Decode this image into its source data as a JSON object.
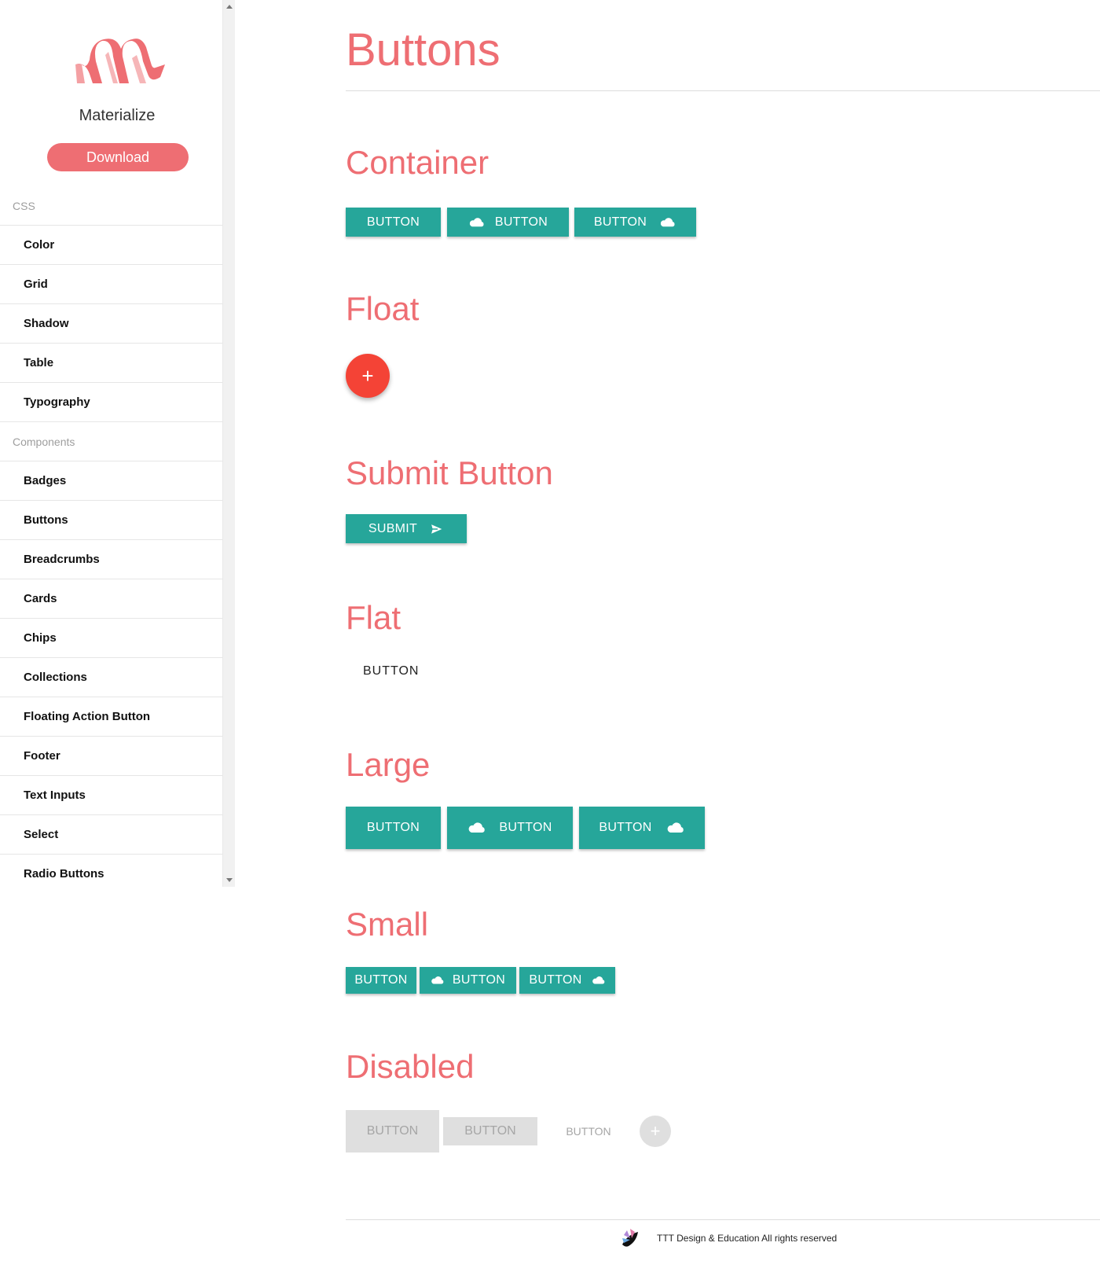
{
  "sidebar": {
    "brand": "Materialize",
    "download_label": "Download",
    "nav": [
      {
        "type": "section",
        "label": "CSS"
      },
      {
        "type": "item",
        "label": "Color"
      },
      {
        "type": "item",
        "label": "Grid"
      },
      {
        "type": "item",
        "label": "Shadow"
      },
      {
        "type": "item",
        "label": "Table"
      },
      {
        "type": "item",
        "label": "Typography"
      },
      {
        "type": "section",
        "label": "Components"
      },
      {
        "type": "item",
        "label": "Badges"
      },
      {
        "type": "item",
        "label": "Buttons"
      },
      {
        "type": "item",
        "label": "Breadcrumbs"
      },
      {
        "type": "item",
        "label": "Cards"
      },
      {
        "type": "item",
        "label": "Chips"
      },
      {
        "type": "item",
        "label": "Collections"
      },
      {
        "type": "item",
        "label": "Floating Action Button"
      },
      {
        "type": "item",
        "label": "Footer"
      },
      {
        "type": "item",
        "label": "Text Inputs"
      },
      {
        "type": "item",
        "label": "Select"
      },
      {
        "type": "item",
        "label": "Radio Buttons"
      }
    ]
  },
  "main": {
    "title": "Buttons",
    "sections": {
      "container": "Container",
      "float": "Float",
      "submit": "Submit Button",
      "flat": "Flat",
      "large": "Large",
      "small": "Small",
      "disabled": "Disabled"
    },
    "button_label": "BUTTON",
    "submit_label": "SUBMIT",
    "fab_label": "+",
    "flat_label": "BUTTON",
    "disabled_fab_label": "+"
  },
  "footer": {
    "text": "TTT Design & Education All rights reserved"
  },
  "colors": {
    "accent": "#ee6e73",
    "teal": "#26a69a",
    "fab_red": "#f44336",
    "disabled": "#dfdfdf"
  },
  "icons": {
    "cloud": "cloud-icon",
    "send": "send-icon"
  }
}
